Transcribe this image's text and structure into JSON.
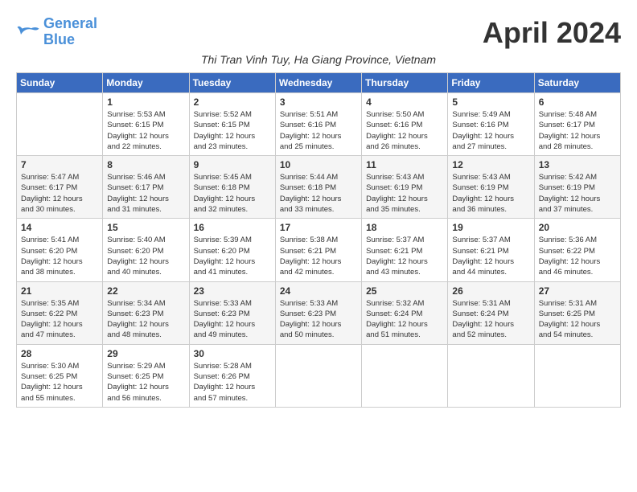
{
  "logo": {
    "line1": "General",
    "line2": "Blue"
  },
  "title": "April 2024",
  "subtitle": "Thi Tran Vinh Tuy, Ha Giang Province, Vietnam",
  "days_of_week": [
    "Sunday",
    "Monday",
    "Tuesday",
    "Wednesday",
    "Thursday",
    "Friday",
    "Saturday"
  ],
  "weeks": [
    [
      {
        "day": "",
        "info": ""
      },
      {
        "day": "1",
        "info": "Sunrise: 5:53 AM\nSunset: 6:15 PM\nDaylight: 12 hours\nand 22 minutes."
      },
      {
        "day": "2",
        "info": "Sunrise: 5:52 AM\nSunset: 6:15 PM\nDaylight: 12 hours\nand 23 minutes."
      },
      {
        "day": "3",
        "info": "Sunrise: 5:51 AM\nSunset: 6:16 PM\nDaylight: 12 hours\nand 25 minutes."
      },
      {
        "day": "4",
        "info": "Sunrise: 5:50 AM\nSunset: 6:16 PM\nDaylight: 12 hours\nand 26 minutes."
      },
      {
        "day": "5",
        "info": "Sunrise: 5:49 AM\nSunset: 6:16 PM\nDaylight: 12 hours\nand 27 minutes."
      },
      {
        "day": "6",
        "info": "Sunrise: 5:48 AM\nSunset: 6:17 PM\nDaylight: 12 hours\nand 28 minutes."
      }
    ],
    [
      {
        "day": "7",
        "info": "Sunrise: 5:47 AM\nSunset: 6:17 PM\nDaylight: 12 hours\nand 30 minutes."
      },
      {
        "day": "8",
        "info": "Sunrise: 5:46 AM\nSunset: 6:17 PM\nDaylight: 12 hours\nand 31 minutes."
      },
      {
        "day": "9",
        "info": "Sunrise: 5:45 AM\nSunset: 6:18 PM\nDaylight: 12 hours\nand 32 minutes."
      },
      {
        "day": "10",
        "info": "Sunrise: 5:44 AM\nSunset: 6:18 PM\nDaylight: 12 hours\nand 33 minutes."
      },
      {
        "day": "11",
        "info": "Sunrise: 5:43 AM\nSunset: 6:19 PM\nDaylight: 12 hours\nand 35 minutes."
      },
      {
        "day": "12",
        "info": "Sunrise: 5:43 AM\nSunset: 6:19 PM\nDaylight: 12 hours\nand 36 minutes."
      },
      {
        "day": "13",
        "info": "Sunrise: 5:42 AM\nSunset: 6:19 PM\nDaylight: 12 hours\nand 37 minutes."
      }
    ],
    [
      {
        "day": "14",
        "info": "Sunrise: 5:41 AM\nSunset: 6:20 PM\nDaylight: 12 hours\nand 38 minutes."
      },
      {
        "day": "15",
        "info": "Sunrise: 5:40 AM\nSunset: 6:20 PM\nDaylight: 12 hours\nand 40 minutes."
      },
      {
        "day": "16",
        "info": "Sunrise: 5:39 AM\nSunset: 6:20 PM\nDaylight: 12 hours\nand 41 minutes."
      },
      {
        "day": "17",
        "info": "Sunrise: 5:38 AM\nSunset: 6:21 PM\nDaylight: 12 hours\nand 42 minutes."
      },
      {
        "day": "18",
        "info": "Sunrise: 5:37 AM\nSunset: 6:21 PM\nDaylight: 12 hours\nand 43 minutes."
      },
      {
        "day": "19",
        "info": "Sunrise: 5:37 AM\nSunset: 6:21 PM\nDaylight: 12 hours\nand 44 minutes."
      },
      {
        "day": "20",
        "info": "Sunrise: 5:36 AM\nSunset: 6:22 PM\nDaylight: 12 hours\nand 46 minutes."
      }
    ],
    [
      {
        "day": "21",
        "info": "Sunrise: 5:35 AM\nSunset: 6:22 PM\nDaylight: 12 hours\nand 47 minutes."
      },
      {
        "day": "22",
        "info": "Sunrise: 5:34 AM\nSunset: 6:23 PM\nDaylight: 12 hours\nand 48 minutes."
      },
      {
        "day": "23",
        "info": "Sunrise: 5:33 AM\nSunset: 6:23 PM\nDaylight: 12 hours\nand 49 minutes."
      },
      {
        "day": "24",
        "info": "Sunrise: 5:33 AM\nSunset: 6:23 PM\nDaylight: 12 hours\nand 50 minutes."
      },
      {
        "day": "25",
        "info": "Sunrise: 5:32 AM\nSunset: 6:24 PM\nDaylight: 12 hours\nand 51 minutes."
      },
      {
        "day": "26",
        "info": "Sunrise: 5:31 AM\nSunset: 6:24 PM\nDaylight: 12 hours\nand 52 minutes."
      },
      {
        "day": "27",
        "info": "Sunrise: 5:31 AM\nSunset: 6:25 PM\nDaylight: 12 hours\nand 54 minutes."
      }
    ],
    [
      {
        "day": "28",
        "info": "Sunrise: 5:30 AM\nSunset: 6:25 PM\nDaylight: 12 hours\nand 55 minutes."
      },
      {
        "day": "29",
        "info": "Sunrise: 5:29 AM\nSunset: 6:25 PM\nDaylight: 12 hours\nand 56 minutes."
      },
      {
        "day": "30",
        "info": "Sunrise: 5:28 AM\nSunset: 6:26 PM\nDaylight: 12 hours\nand 57 minutes."
      },
      {
        "day": "",
        "info": ""
      },
      {
        "day": "",
        "info": ""
      },
      {
        "day": "",
        "info": ""
      },
      {
        "day": "",
        "info": ""
      }
    ]
  ]
}
